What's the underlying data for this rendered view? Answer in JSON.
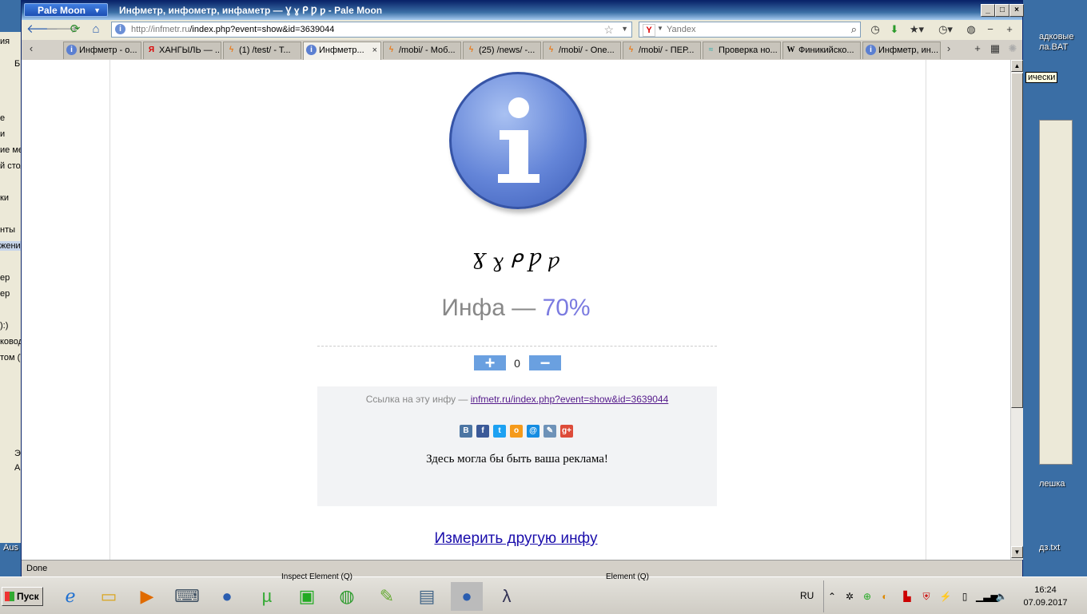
{
  "desktop": {
    "left_panel_rows": [
      "ия",
      "Б",
      "е",
      "и",
      "ие ме",
      "й стол",
      "ки",
      "нты",
      "жения",
      "ер",
      "ер",
      "):)",
      "ковод",
      "том (Т",
      "Э",
      "А",
      "Aus"
    ],
    "right_labels": [
      "адковые",
      "ла.BAT",
      "лешка",
      "дз.txt",
      "ически"
    ]
  },
  "window": {
    "app_menu": "Pale Moon",
    "title": "Инфметр, инфометр, инфаметр — Ɣ ɣ ᑭ Ƿ ƿ - Pale Moon",
    "controls": {
      "minimize": "_",
      "maximize": "□",
      "close": "×"
    }
  },
  "nav": {
    "url_host": "http://infmetr.ru",
    "url_path": "/index.php?event=show&id=3639044",
    "search_placeholder": "Yandex"
  },
  "tabs": [
    {
      "label": "Инфметр - о...",
      "icon": "info"
    },
    {
      "label": "ХАНГЫЛЬ — ...",
      "icon": "ya"
    },
    {
      "label": "(1) /test/ - T...",
      "icon": "bolt"
    },
    {
      "label": "Инфметр...",
      "icon": "info",
      "active": true
    },
    {
      "label": "/mobi/ - Моб...",
      "icon": "bolt"
    },
    {
      "label": "(25) /news/ -...",
      "icon": "bolt"
    },
    {
      "label": "/mobi/ - One...",
      "icon": "bolt"
    },
    {
      "label": "/mobi/ - ПЕР...",
      "icon": "bolt"
    },
    {
      "label": "Проверка но...",
      "icon": "wave"
    },
    {
      "label": "Финикийско...",
      "icon": "w"
    },
    {
      "label": "Инфметр, ин...",
      "icon": "info"
    }
  ],
  "page": {
    "word": "Ɣ ɣ ᑭ Ƿ ƿ",
    "infa_label": "Инфа — ",
    "infa_value": "70%",
    "vote_plus": "+",
    "vote_count": "0",
    "vote_minus": "−",
    "link_prefix": "Ссылка на эту инфу — ",
    "link_text": "infmetr.ru/index.php?event=show&id=3639044",
    "share_icons": [
      "vk",
      "facebook",
      "twitter",
      "odnoklassniki",
      "mailru",
      "livejournal",
      "googleplus"
    ],
    "ad_text": "Здесь могла бы быть ваша реклама!",
    "measure_link": "Измерить другую инфу"
  },
  "status": {
    "text": "Done"
  },
  "taskbar": {
    "start_label": "Пуск",
    "lang": "RU",
    "time": "16:24",
    "date": "07.09.2017",
    "behind_text_1": "Inspect Element (Q)",
    "behind_text_2": "Element (Q)"
  },
  "colors": {
    "accent": "#7b7be0",
    "link": "#551a8b",
    "vote_button": "#6aa0e0"
  }
}
